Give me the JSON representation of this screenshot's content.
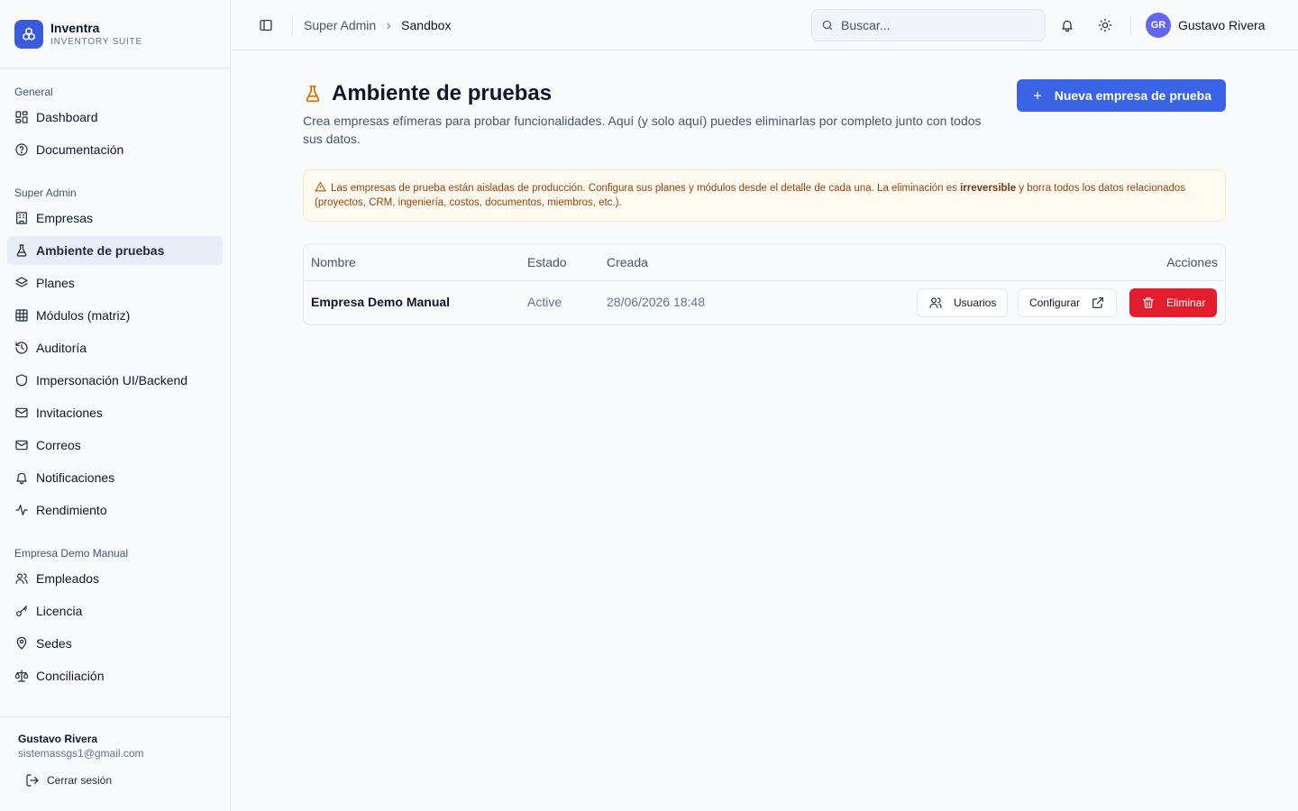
{
  "brand": {
    "name": "Inventra",
    "subtitle": "INVENTORY SUITE",
    "logo_icon": "cube-cluster-icon",
    "color": "#3b5bdb"
  },
  "sidebar": {
    "groups": [
      {
        "title": "General",
        "items": [
          {
            "label": "Dashboard",
            "icon": "layout-grid-icon"
          },
          {
            "label": "Documentación",
            "icon": "help-circle-icon"
          }
        ]
      },
      {
        "title": "Super Admin",
        "items": [
          {
            "label": "Empresas",
            "icon": "building-icon"
          },
          {
            "label": "Ambiente de pruebas",
            "icon": "flask-icon",
            "active": true
          },
          {
            "label": "Planes",
            "icon": "layers-icon"
          },
          {
            "label": "Módulos (matriz)",
            "icon": "table-icon"
          },
          {
            "label": "Auditoría",
            "icon": "history-icon"
          },
          {
            "label": "Impersonación UI/Backend",
            "icon": "shield-icon"
          },
          {
            "label": "Invitaciones",
            "icon": "mail-icon"
          },
          {
            "label": "Correos",
            "icon": "mail-icon"
          },
          {
            "label": "Notificaciones",
            "icon": "bell-icon"
          },
          {
            "label": "Rendimiento",
            "icon": "activity-icon"
          }
        ]
      },
      {
        "title": "Empresa Demo Manual",
        "items": [
          {
            "label": "Empleados",
            "icon": "users-icon"
          },
          {
            "label": "Licencia",
            "icon": "key-icon"
          },
          {
            "label": "Sedes",
            "icon": "map-pin-icon"
          },
          {
            "label": "Conciliación",
            "icon": "scale-icon"
          }
        ]
      }
    ],
    "footer": {
      "user_name": "Gustavo Rivera",
      "email": "sistemassgs1@gmail.com",
      "logout_label": "Cerrar sesión"
    }
  },
  "topbar": {
    "breadcrumb": [
      "Super Admin",
      "Sandbox"
    ],
    "search_placeholder": "Buscar...",
    "user": {
      "initials": "GR",
      "name": "Gustavo Rivera",
      "avatar_color": "#6366f1"
    }
  },
  "page": {
    "title": "Ambiente de pruebas",
    "subtitle": "Crea empresas efímeras para probar funcionalidades. Aquí (y solo aquí) puedes eliminarlas por completo junto con todos sus datos.",
    "new_button": "Nueva empresa de prueba",
    "alert": {
      "before": "Las empresas de prueba están aisladas de producción. Configura sus planes y módulos desde el detalle de cada una. La eliminación es ",
      "strong": "irreversible",
      "after": " y borra todos los datos relacionados (proyectos, CRM, ingeniería, costos, documentos, miembros, etc.)."
    },
    "table": {
      "headers": {
        "name": "Nombre",
        "status": "Estado",
        "created": "Creada",
        "actions": "Acciones"
      },
      "rows": [
        {
          "name": "Empresa Demo Manual",
          "status": "Active",
          "created": "28/06/2026 18:48",
          "actions": {
            "users": "Usuarios",
            "configure": "Configurar",
            "delete": "Eliminar"
          }
        }
      ]
    }
  },
  "colors": {
    "primary": "#3b63e6",
    "danger": "#e11d2e",
    "warning_icon": "#d97706",
    "active_nav_bg": "#e8eef8"
  }
}
